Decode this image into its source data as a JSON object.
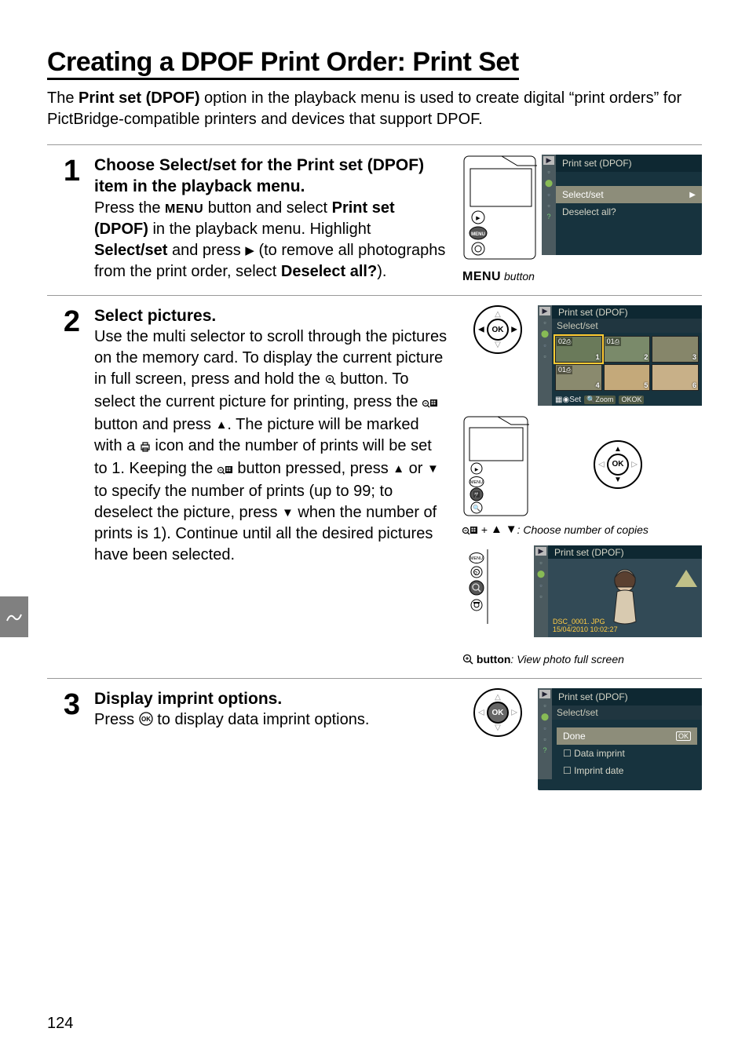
{
  "page": {
    "title": "Creating a DPOF Print Order: Print Set",
    "intro_prefix": "The ",
    "intro_bold": "Print set (DPOF)",
    "intro_suffix": " option in the playback menu is used to create digital “print orders” for PictBridge-compatible printers and devices that support DPOF.",
    "page_number": "124"
  },
  "step1": {
    "number": "1",
    "heading_part1": "Choose ",
    "heading_bold1": "Select/set",
    "heading_part2": " for the ",
    "heading_bold2": "Print set (DPOF)",
    "heading_part3": " item in the playback menu.",
    "body_a": "Press the ",
    "menu_label": "MENU",
    "body_b": " button and select ",
    "body_bold1": "Print set (DPOF)",
    "body_c": " in the playback menu.  Highlight ",
    "body_bold2": "Select/set",
    "body_d": " and press ",
    "body_e": " (to remove all photographs from the print order, select ",
    "body_bold3": "Deselect all?",
    "body_f": ").",
    "caption": " button",
    "lcd": {
      "title": "Print set (DPOF)",
      "row1": "Select/set",
      "row2": "Deselect all?"
    }
  },
  "step2": {
    "number": "2",
    "heading": "Select pictures.",
    "body": {
      "p1": "Use the multi selector to scroll through the pictures on the memory card.  To display the current picture in full screen, press and hold the ",
      "p2": " button.  To select the current picture for printing, press the ",
      "p3": " button and press ",
      "p4": ".  The picture will be marked with a ",
      "p5": " icon and the number of prints will be set to 1.  Keeping the ",
      "p6": " button pressed, press ",
      "p7": " or ",
      "p8": " to specify the number of prints (up to 99; to deselect the picture, press ",
      "p9": " when the number of prints is 1).  Continue until all the desired pictures have been selected."
    },
    "lcd_grid": {
      "title": "Print set (DPOF)",
      "subtitle": "Select/set",
      "thumbs": [
        {
          "badge": "02",
          "idx": "1"
        },
        {
          "badge": "01",
          "idx": "2"
        },
        {
          "badge": "",
          "idx": "3"
        },
        {
          "badge": "01",
          "idx": "4"
        },
        {
          "badge": "",
          "idx": "5"
        },
        {
          "badge": "",
          "idx": "6"
        }
      ],
      "footer_set": "Set",
      "footer_zoom": "Zoom",
      "footer_ok": "OK"
    },
    "caption1_prefix": " + ",
    "caption1_suffix": ": Choose number of copies",
    "lcd_full": {
      "title": "Print set (DPOF)",
      "filename": "DSC_0001. JPG",
      "datetime": "15/04/2010 10:02:27"
    },
    "caption2_bold": " button",
    "caption2_rest": ": View photo full screen"
  },
  "step3": {
    "number": "3",
    "heading": "Display imprint options.",
    "body_a": "Press ",
    "body_b": " to display data imprint options.",
    "lcd": {
      "title": "Print set (DPOF)",
      "subtitle": "Select/set",
      "row_done": "Done",
      "row_ok_badge": "OK",
      "row_data": "Data imprint",
      "row_date": "Imprint date"
    }
  },
  "ok_label": "OK"
}
